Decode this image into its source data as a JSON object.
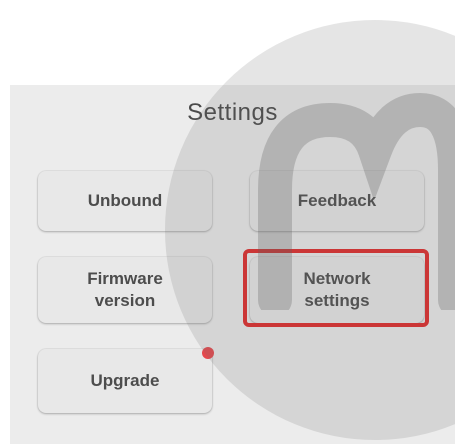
{
  "settings": {
    "title": "Settings",
    "buttons": {
      "unbound": "Unbound",
      "feedback": "Feedback",
      "firmware": "Firmware\nversion",
      "network": "Network\nsettings",
      "upgrade": "Upgrade"
    }
  },
  "colors": {
    "highlight": "#e02a2a",
    "notification_dot": "#e5484d"
  },
  "icons": {
    "upgrade_badge": "notification-dot-icon"
  }
}
